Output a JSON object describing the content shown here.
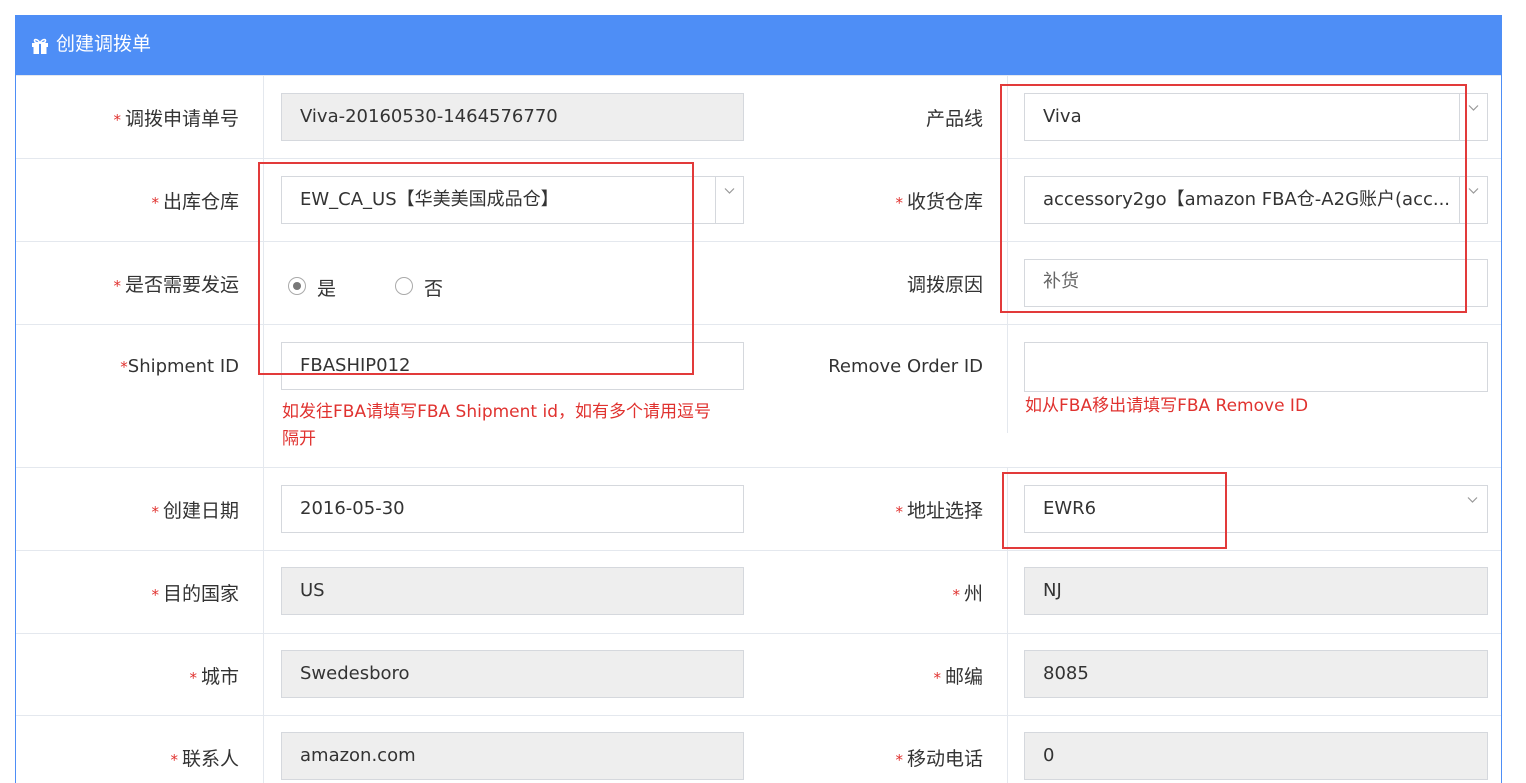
{
  "header": {
    "title": "创建调拨单",
    "icon": "gift-icon"
  },
  "required_mark": "*",
  "rows": {
    "r1": {
      "left_label": "调拨申请单号",
      "left_value": "Viva-20160530-1464576770",
      "right_label": "产品线",
      "right_value": "Viva"
    },
    "r2": {
      "left_label": "出库仓库",
      "left_value": "EW_CA_US【华美美国成品仓】",
      "right_label": "收货仓库",
      "right_value": "accessory2go【amazon FBA仓-A2G账户(acc..."
    },
    "r3": {
      "left_label": "是否需要发运",
      "radio_yes": "是",
      "radio_no": "否",
      "selected": "是",
      "right_label": "调拨原因",
      "right_value": "补货"
    },
    "r4": {
      "left_label": "Shipment ID",
      "left_value": "FBASHIP012",
      "left_hint_line1": "如发往FBA请填写FBA Shipment id，如有多个请用逗号",
      "left_hint_line2": "隔开",
      "right_label": "Remove Order ID",
      "right_value": "",
      "right_hint": "如从FBA移出请填写FBA Remove ID"
    },
    "r5": {
      "left_label": "创建日期",
      "left_value": "2016-05-30",
      "right_label": "地址选择",
      "right_value": "EWR6"
    },
    "r6": {
      "left_label": "目的国家",
      "left_value": "US",
      "right_label": "州",
      "right_value": "NJ"
    },
    "r7": {
      "left_label": "城市",
      "left_value": "Swedesboro",
      "right_label": "邮编",
      "right_value": "8085"
    },
    "r8": {
      "left_label": "联系人",
      "left_value": "amazon.com",
      "right_label": "移动电话",
      "right_value": "0"
    }
  },
  "colors": {
    "header_bg": "#4e8ef6",
    "required": "#e0322f",
    "annotation_box": "#e23a3a",
    "readonly_bg": "#eeeeee"
  }
}
